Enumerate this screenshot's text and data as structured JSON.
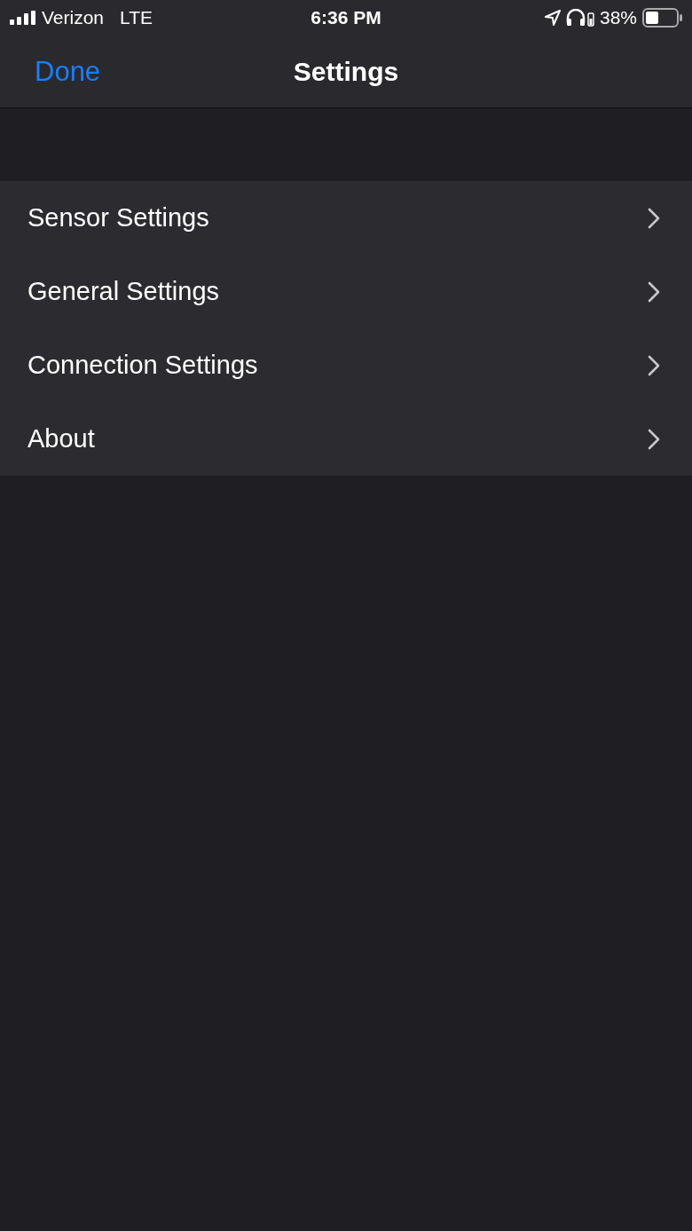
{
  "status_bar": {
    "carrier": "Verizon",
    "network": "LTE",
    "time": "6:36 PM",
    "battery_percent": "38%"
  },
  "nav_bar": {
    "back_button": "Done",
    "title": "Settings"
  },
  "menu_items": [
    {
      "label": "Sensor Settings"
    },
    {
      "label": "General Settings"
    },
    {
      "label": "Connection Settings"
    },
    {
      "label": "About"
    }
  ]
}
